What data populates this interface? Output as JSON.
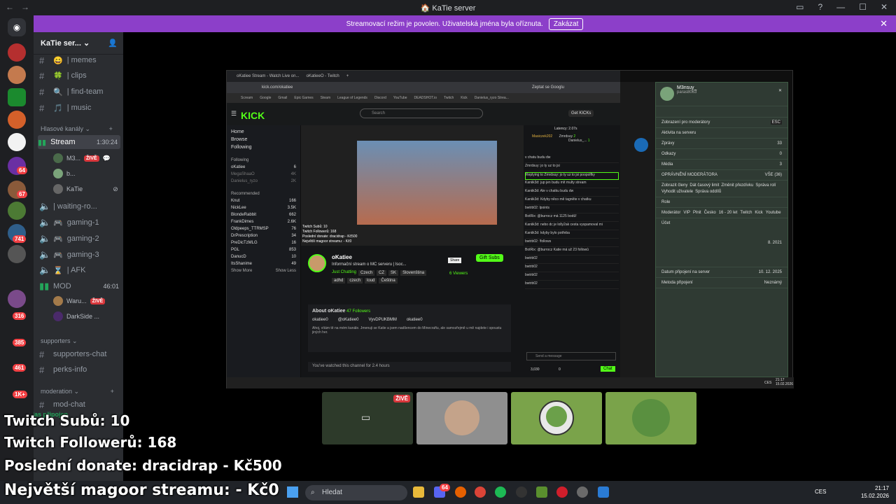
{
  "window": {
    "title": "KaTie server",
    "nav_back": "←",
    "nav_fwd": "→"
  },
  "banner": {
    "text": "Streamovací režim je povolen. Uživatelská jména byla oříznuta.",
    "button": "Zakázat"
  },
  "server": {
    "name": "KaTie ser...",
    "chevron": "⌄"
  },
  "channels": [
    {
      "icon": "😄",
      "name": "| memes"
    },
    {
      "icon": "🍀",
      "name": "| clips"
    },
    {
      "icon": "🔍",
      "name": "| find-team"
    },
    {
      "icon": "🎵",
      "name": "| music"
    }
  ],
  "voice_category": "Hlasové kanály",
  "stream_channel": {
    "name": "Stream",
    "time": "1:30:24"
  },
  "stream_users": [
    {
      "name": "M3...",
      "live": "ŽIVĚ"
    },
    {
      "name": "b...",
      "live": ""
    },
    {
      "name": "KaTie",
      "live": ""
    }
  ],
  "voice_channels": [
    "| waiting-ro...",
    "gaming-1",
    "gaming-2",
    "gaming-3",
    "| AFK"
  ],
  "mod_channel": {
    "name": "MOD",
    "time": "46:01"
  },
  "mod_users": [
    {
      "name": "Waru...",
      "live": "ŽIVĚ"
    },
    {
      "name": "DarkSide ...",
      "live": ""
    }
  ],
  "supporters": {
    "category": "supporters",
    "channels": [
      "supporters-chat",
      "perks-info"
    ]
  },
  "moderation": {
    "category": "moderation",
    "channel": "mod-chat"
  },
  "voice_connected": "Hlas připojen",
  "server_badges": [
    "64",
    "67",
    "741",
    "316",
    "385",
    "461",
    "1K+"
  ],
  "stream_view": {
    "browser_tabs": [
      "oKatiee Stream - Watch Live on...",
      "oKatieeO - Twitch"
    ],
    "url": "kick.com/okatiee",
    "translate": "Zeptat se Googlu",
    "bookmarks": [
      "Scream",
      "Google",
      "Gmail",
      "Epic Games",
      "Steam",
      "League of Legends",
      "Discord",
      "YouTube",
      "DEADSHOT.io",
      "Twitch",
      "Kick",
      "Danielus_ryzo Strea..."
    ],
    "kick_logo": "KICK",
    "search": "Search",
    "get_kicks": "Get KICKs",
    "nav": [
      "Home",
      "Browse",
      "Following"
    ],
    "following_title": "Following",
    "following": [
      {
        "name": "oKatiee",
        "sub": "Just Chatting",
        "count": "6"
      },
      {
        "name": "MegaShaaO",
        "sub": "",
        "count": "4K"
      },
      {
        "name": "Danielus_ryzo",
        "sub": "",
        "count": "2K"
      }
    ],
    "recommended_title": "Recommended",
    "recommended": [
      {
        "name": "Knut",
        "sub": "IRL",
        "count": "166"
      },
      {
        "name": "NickLee",
        "sub": "IRL",
        "count": "3.5K"
      },
      {
        "name": "BlondeRabbit",
        "sub": "Slots & Casino",
        "count": "662"
      },
      {
        "name": "FrankDimes",
        "sub": "Slots & Casino",
        "count": "2.6K"
      },
      {
        "name": "Oldpeeps_TTRMSP",
        "sub": "Just Chatting",
        "count": "76"
      },
      {
        "name": "DrPrescription",
        "sub": "Call of Duty: Black Ops 7",
        "count": "34"
      },
      {
        "name": "PreDicTzMLG",
        "sub": "Battlefield REDSEC",
        "count": "16"
      },
      {
        "name": "PGL",
        "sub": "Counter-Strike 2",
        "count": "853"
      },
      {
        "name": "DanucD",
        "sub": "PUBG: Battlegrounds",
        "count": "10"
      },
      {
        "name": "ItsShanime",
        "sub": "Minecraft",
        "count": "49"
      }
    ],
    "show_more": "Show More",
    "show_less": "Show Less",
    "video_overlay": [
      "Twitch Subů: 10",
      "Twitch Followerů: 168",
      "Poslední donate: dracidrap - Kč500",
      "Největší magoor streamu: - Kč0"
    ],
    "streamer": "oKatiee",
    "stream_title": "Informační stream o MC serveru | lsoc...",
    "tags": [
      "Just Chatting",
      "Czech",
      "CZ",
      "SK",
      "Slovenština",
      "adhd",
      "czech",
      "loud",
      "Čeština"
    ],
    "gift_subs": "Gift Subs",
    "share": "Share",
    "viewers": "6 Viewers",
    "about_title": "About oKatiee",
    "about_followers": "47 Followers",
    "socials": [
      "okatiee0",
      "@oKatiee0",
      "VyvDPUKBMM",
      "okatiee0"
    ],
    "about_text": "Ahoj, vítám tě na mém kanále. Jmenuji se Katie a jsem nadšencem do Minecraftu, ale samozřejmě u mě najdete i spoustu jiných her.",
    "watched": "You've watched this channel for 2.4 hours",
    "latency": "Latency: 2.07s",
    "chat_top": [
      "Masiczek202",
      "Zmrdsuy",
      "Danielus_..."
    ],
    "chat_top_counts": [
      "2",
      "1"
    ],
    "chat_msgs": [
      "v chatu budu dw",
      "Zmrdsuy: jo ty uz to jsi",
      "Replying to Zmrdsuy: jo ty uz to jsi poopolfky",
      "Kaniik3d: jup jen budu mít multy stream",
      "Kaniik3d: Ale v chatku budu dw",
      "Kaniik3d: Kdyby něco mě tagněte v chatku",
      "bwtrb02: lpoints",
      "BotRix: @burrocz má 1125 bodů!",
      "Kaniik3d: nebo dc je lolly2ak cesta vyspamoval mi",
      "Kaniik3d: kdyby bylo potřeba",
      "bwtrb02: !follows",
      "BotRix: @burrocz Katie má už 23 followů",
      "bwtrb02",
      "bwtrb02",
      "bwtrb02",
      "bwtrb02"
    ],
    "chat_placeholder": "Send a message",
    "chat_kicks": "3,030",
    "chat_zero": "0",
    "chat_button": "Chat",
    "mod": {
      "user": "M3nsuy_",
      "handle": "paras8063",
      "view": "Zobrazení pro moderátory",
      "esc": "ESC",
      "activity": "Aktivita na serveru",
      "rows": [
        {
          "label": "Zprávy",
          "value": "33"
        },
        {
          "label": "Odkazy",
          "value": "0"
        },
        {
          "label": "Média",
          "value": "3"
        }
      ],
      "perm_title": "OPRÁVNĚNÍ MODERÁTORA",
      "perm_all": "VŠE (36)",
      "perms": [
        "Zobrazit členy",
        "Dát časový limit",
        "Změnit přezdívku",
        "Správa rolí",
        "Vyhodit uživatele",
        "Správa oddílů"
      ],
      "roles_title": "Role",
      "roles": [
        "Moderátor",
        "VIP",
        "Plnit",
        "Česko",
        "16 - 20 let",
        "Twitch",
        "Kick",
        "Youtube"
      ],
      "account_title": "Účet",
      "join_label": "Datum připojení na server",
      "join_date": "10. 12. 2025",
      "join_method": "Metoda připojení",
      "join_method_val": "Neznámý",
      "acc_date": "8. 2021"
    },
    "mini_clock": [
      "21:17",
      "15.02.2026"
    ],
    "mini_lang": "CES"
  },
  "tiles": [
    {
      "live": "ŽIVĚ"
    },
    {
      "live": ""
    },
    {
      "live": ""
    },
    {
      "live": ""
    }
  ],
  "overlay": [
    "Twitch Subů: 10",
    "Twitch Followerů: 168",
    "Poslední donate: dracidrap - Kč500",
    "Největší magoor streamu:  - Kč0"
  ],
  "taskbar": {
    "search": "Hledat",
    "lang": "CES",
    "time": "21:17",
    "date": "15.02.2026",
    "discord_badge": "64"
  }
}
